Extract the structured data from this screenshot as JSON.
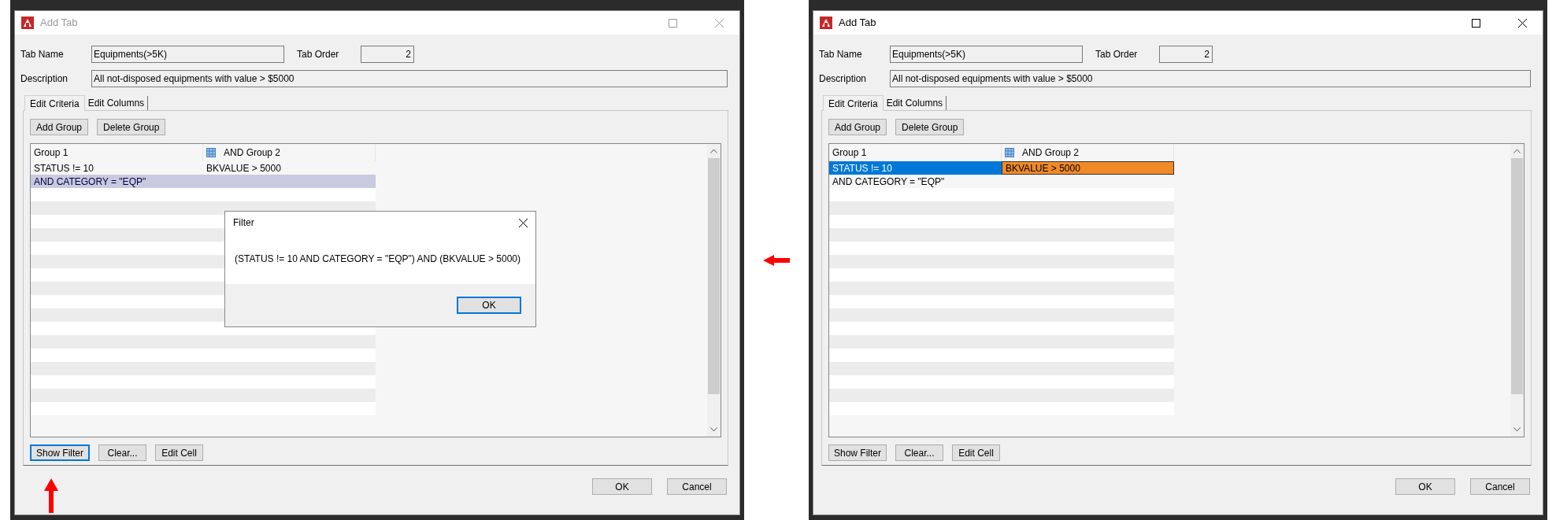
{
  "screens": [
    {
      "dialog": {
        "title": "Add Tab",
        "active": false
      },
      "form": {
        "tab_name": {
          "label": "Tab Name",
          "value": "Equipments(>5K)"
        },
        "tab_order": {
          "label": "Tab Order",
          "value": "2"
        },
        "description": {
          "label": "Description",
          "value": "All not-disposed equipments with value > $5000"
        }
      },
      "tabs": [
        {
          "label": "Edit Criteria",
          "selected": true
        },
        {
          "label": "Edit Columns",
          "selected": false
        }
      ],
      "group_buttons": [
        "Add Group",
        "Delete Group"
      ],
      "grid": {
        "columns": [
          {
            "label": "Group 1",
            "kind": "plain"
          },
          {
            "label": "AND Group 2",
            "kind": "icon"
          }
        ],
        "rows": [
          {
            "cells": [
              {
                "text": "STATUS != 10",
                "kind": "plain"
              },
              {
                "text": "BKVALUE > 5000",
                "kind": "plain"
              }
            ]
          },
          {
            "cells": [
              {
                "text": "AND CATEGORY = \"EQP\"",
                "kind": "highlighted"
              },
              {
                "kind": "highlighted"
              }
            ]
          }
        ]
      },
      "action_buttons": [
        {
          "label": "Show Filter",
          "focused": true
        },
        {
          "label": "Clear...",
          "focused": false
        },
        {
          "label": "Edit Cell",
          "focused": false
        }
      ],
      "footer_buttons": [
        "OK",
        "Cancel"
      ],
      "filter_popup": {
        "title": "Filter",
        "message": "(STATUS != 10 AND CATEGORY = \"EQP\") AND (BKVALUE > 5000)",
        "button": {
          "label": "OK",
          "focused": true
        }
      }
    },
    {
      "dialog": {
        "title": "Add Tab",
        "active": true
      },
      "form": {
        "tab_name": {
          "label": "Tab Name",
          "value": "Equipments(>5K)"
        },
        "tab_order": {
          "label": "Tab Order",
          "value": "2"
        },
        "description": {
          "label": "Description",
          "value": "All not-disposed equipments with value > $5000"
        }
      },
      "tabs": [
        {
          "label": "Edit Criteria",
          "selected": true
        },
        {
          "label": "Edit Columns",
          "selected": false
        }
      ],
      "group_buttons": [
        "Add Group",
        "Delete Group"
      ],
      "grid": {
        "columns": [
          {
            "label": "Group 1",
            "kind": "plain"
          },
          {
            "label": "AND Group 2",
            "kind": "icon"
          }
        ],
        "rows": [
          {
            "cells": [
              {
                "text": "STATUS != 10",
                "kind": "selected"
              },
              {
                "text": "BKVALUE > 5000",
                "kind": "current"
              }
            ]
          },
          {
            "cells": [
              {
                "text": "AND CATEGORY = \"EQP\"",
                "kind": "plain"
              }
            ]
          }
        ]
      },
      "action_buttons": [
        {
          "label": "Show Filter",
          "focused": false
        },
        {
          "label": "Clear...",
          "focused": false
        },
        {
          "label": "Edit Cell",
          "focused": false
        }
      ],
      "footer_buttons": [
        "OK",
        "Cancel"
      ]
    }
  ]
}
